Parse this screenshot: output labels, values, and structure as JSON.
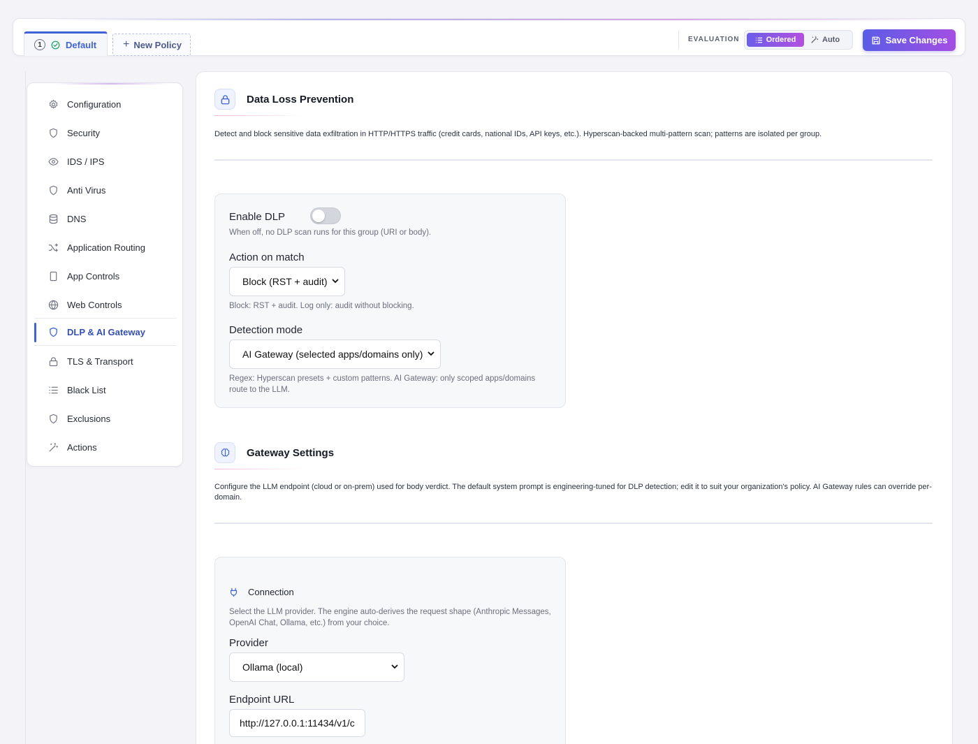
{
  "topbar": {
    "tabs": [
      {
        "badge": "1",
        "label": "Default"
      },
      {
        "label": "New Policy"
      }
    ],
    "evaluation_label": "EVALUATION",
    "evaluation_options": {
      "ordered": "Ordered",
      "auto": "Auto"
    },
    "save_label": "Save Changes"
  },
  "sidebar": {
    "items": [
      {
        "label": "Configuration",
        "icon": "gear-icon"
      },
      {
        "label": "Security",
        "icon": "shield-icon"
      },
      {
        "label": "IDS / IPS",
        "icon": "eye-icon"
      },
      {
        "label": "Anti Virus",
        "icon": "shield-icon"
      },
      {
        "label": "DNS",
        "icon": "database-icon"
      },
      {
        "label": "Application Routing",
        "icon": "shuffle-icon"
      },
      {
        "label": "App Controls",
        "icon": "phone-icon"
      },
      {
        "label": "Web Controls",
        "icon": "globe-icon"
      },
      {
        "label": "DLP & AI Gateway",
        "icon": "shield-icon",
        "active": true
      },
      {
        "label": "TLS & Transport",
        "icon": "lock-icon"
      },
      {
        "label": "Black List",
        "icon": "list-icon"
      },
      {
        "label": "Exclusions",
        "icon": "shield-icon"
      },
      {
        "label": "Actions",
        "icon": "wand-icon"
      }
    ]
  },
  "dlp": {
    "title": "Data Loss Prevention",
    "description": "Detect and block sensitive data exfiltration in HTTP/HTTPS traffic (credit cards, national IDs, API keys, etc.). Hyperscan-backed multi-pattern scan; patterns are isolated per group.",
    "enable_label": "Enable DLP",
    "enable_on": false,
    "enable_help": "When off, no DLP scan runs for this group (URI or body).",
    "action_label": "Action on match",
    "action_value": "Block (RST + audit)",
    "action_help": "Block: RST + audit. Log only: audit without blocking.",
    "mode_label": "Detection mode",
    "mode_value": "AI Gateway (selected apps/domains only)",
    "mode_help": "Regex: Hyperscan presets + custom patterns. AI Gateway: only scoped apps/domains route to the LLM."
  },
  "gateway": {
    "title": "Gateway Settings",
    "description": "Configure the LLM endpoint (cloud or on-prem) used for body verdict. The default system prompt is engineering-tuned for DLP detection; edit it to suit your organization's policy. AI Gateway rules can override per-domain.",
    "connection_title": "Connection",
    "connection_help": "Select the LLM provider. The engine auto-derives the request shape (Anthropic Messages, OpenAI Chat, Ollama, etc.) from your choice.",
    "provider_label": "Provider",
    "provider_value": "Ollama (local)",
    "endpoint_label": "Endpoint URL",
    "endpoint_value": "http://127.0.0.1:11434/v1/c"
  }
}
